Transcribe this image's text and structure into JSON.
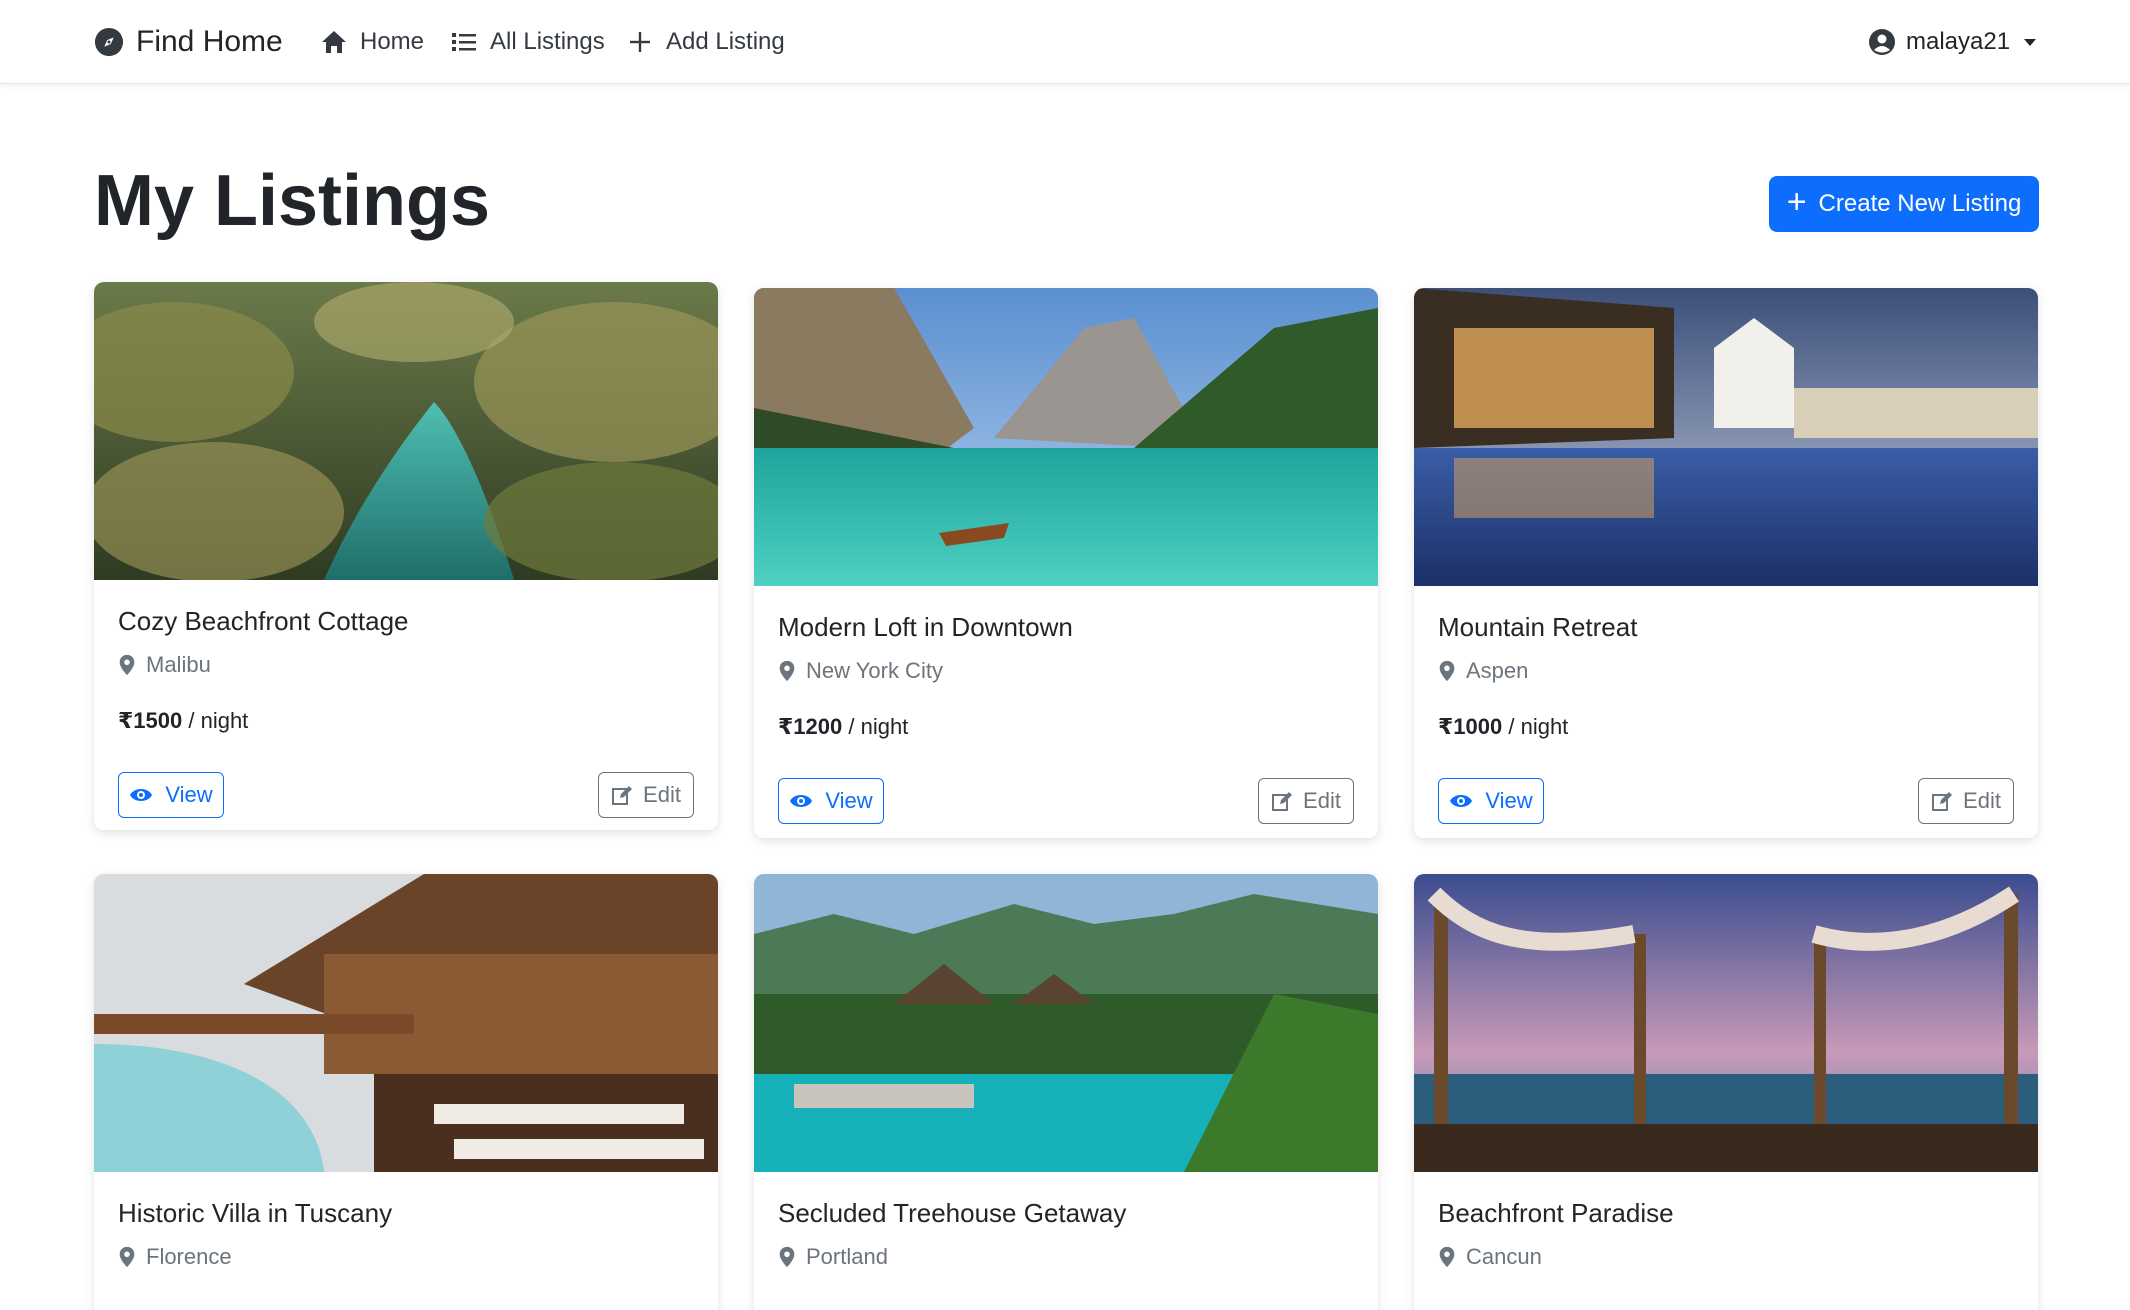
{
  "navbar": {
    "brand": "Find Home",
    "links": [
      {
        "label": "Home",
        "icon": "home-icon"
      },
      {
        "label": "All Listings",
        "icon": "list-icon"
      },
      {
        "label": "Add Listing",
        "icon": "plus-icon"
      }
    ],
    "user": "malaya21"
  },
  "page": {
    "title": "My Listings",
    "create_label": "Create New Listing"
  },
  "colors": {
    "primary": "#0d6efd",
    "secondary": "#6c757d",
    "text": "#212529"
  },
  "listings": [
    {
      "title": "Cozy Beachfront Cottage",
      "location": "Malibu",
      "price": "₹1500",
      "unit": " / night",
      "view_label": "View",
      "edit_label": "Edit"
    },
    {
      "title": "Modern Loft in Downtown",
      "location": "New York City",
      "price": "₹1200",
      "unit": " / night",
      "view_label": "View",
      "edit_label": "Edit"
    },
    {
      "title": "Mountain Retreat",
      "location": "Aspen",
      "price": "₹1000",
      "unit": " / night",
      "view_label": "View",
      "edit_label": "Edit"
    },
    {
      "title": "Historic Villa in Tuscany",
      "location": "Florence",
      "price": "",
      "unit": "",
      "view_label": "",
      "edit_label": ""
    },
    {
      "title": "Secluded Treehouse Getaway",
      "location": "Portland",
      "price": "",
      "unit": "",
      "view_label": "",
      "edit_label": ""
    },
    {
      "title": "Beachfront Paradise",
      "location": "Cancun",
      "price": "",
      "unit": "",
      "view_label": "",
      "edit_label": ""
    }
  ]
}
